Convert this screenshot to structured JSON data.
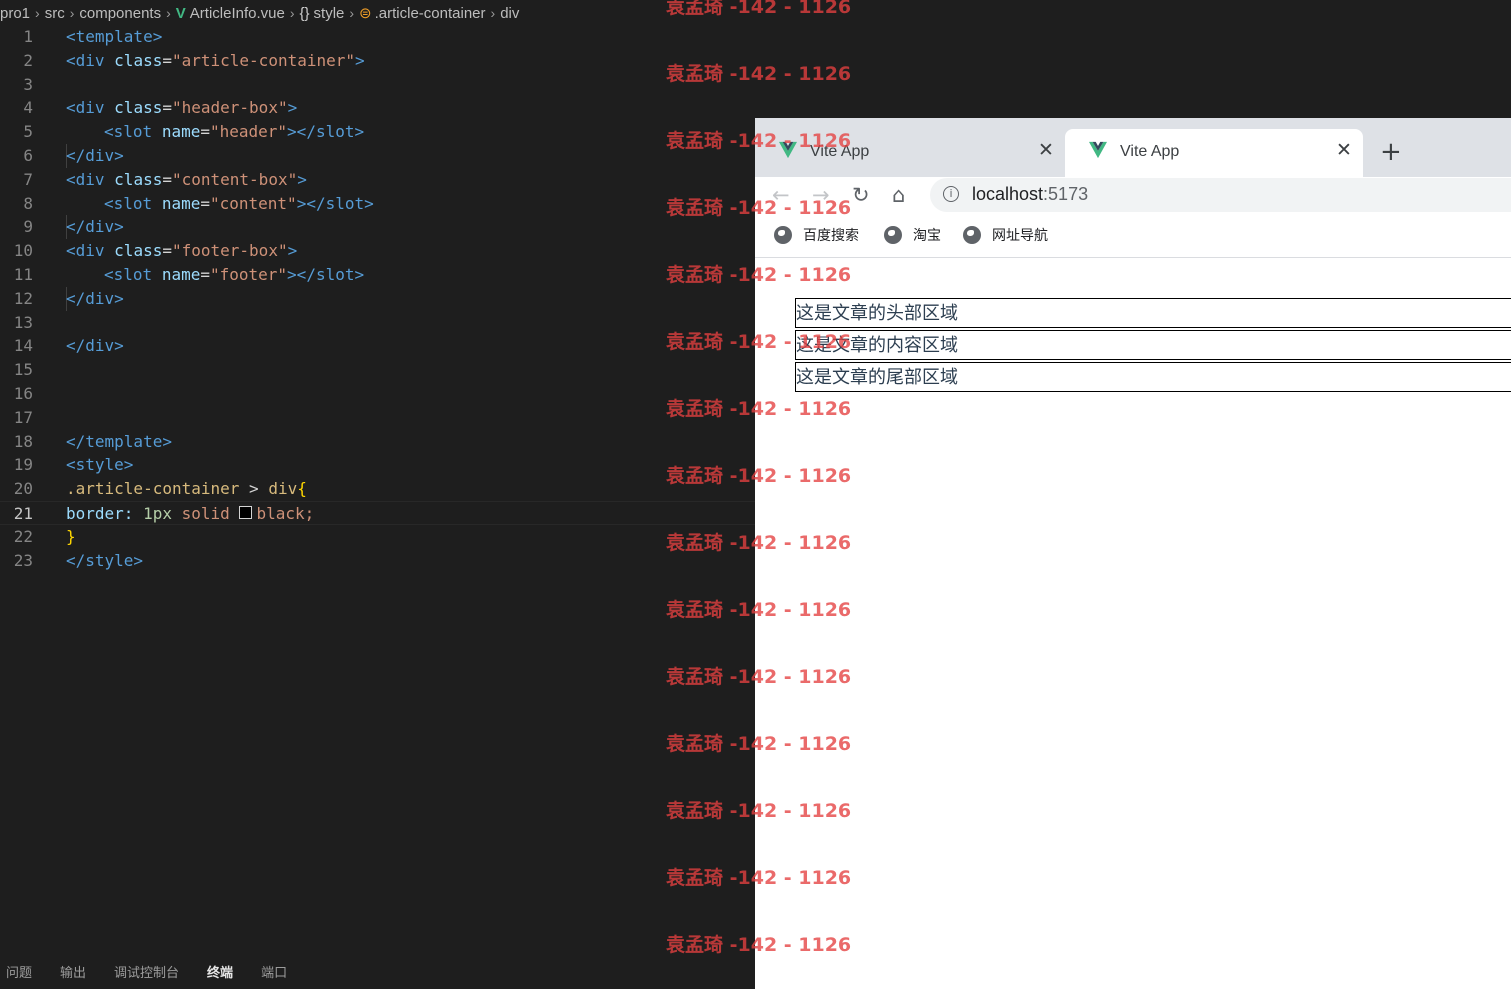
{
  "editor": {
    "breadcrumb": {
      "parts": [
        "pro1",
        "src",
        "components",
        "ArticleInfo.vue",
        "style",
        ".article-container",
        "div"
      ]
    },
    "current_line": 21,
    "lines": [
      {
        "n": "1"
      },
      {
        "n": "2"
      },
      {
        "n": "3"
      },
      {
        "n": "4"
      },
      {
        "n": "5"
      },
      {
        "n": "6"
      },
      {
        "n": "7"
      },
      {
        "n": "8"
      },
      {
        "n": "9"
      },
      {
        "n": "10"
      },
      {
        "n": "11"
      },
      {
        "n": "12"
      },
      {
        "n": "13"
      },
      {
        "n": "14"
      },
      {
        "n": "15"
      },
      {
        "n": "16"
      },
      {
        "n": "17"
      },
      {
        "n": "18"
      },
      {
        "n": "19"
      },
      {
        "n": "20"
      },
      {
        "n": "21"
      },
      {
        "n": "22"
      },
      {
        "n": "23"
      }
    ],
    "code": {
      "l1": "<template>",
      "l2_tag": "<div",
      "l2_attr": "class",
      "l2_val": "\"article-container\"",
      "l4_val": "\"header-box\"",
      "l5_attr": "name",
      "l5_val": "\"header\"",
      "slot_open": "<slot",
      "slot_close": "></slot>",
      "div_close": "</div>",
      "div_open": "<div",
      "class_attr": "class",
      "l7_val": "\"content-box\"",
      "l8_val": "\"content\"",
      "l10_val": "\"footer-box\"",
      "l11_val": "\"footer\"",
      "l18": "</template>",
      "l19": "<style>",
      "l20_sel": ".article-container",
      "l20_gt": ">",
      "l20_div": "div",
      "l20_brace": "{",
      "l21_prop": "border:",
      "l21_num": "1px",
      "l21_kw": "solid",
      "l21_color": "black;",
      "l22": "}",
      "l23": "</style>",
      "eq": "=",
      "gt": ">"
    },
    "panel_tabs": [
      "问题",
      "输出",
      "调试控制台",
      "终端",
      "端口"
    ],
    "panel_active": "终端"
  },
  "browser": {
    "tabs": [
      {
        "title": "Vite App"
      },
      {
        "title": "Vite App"
      }
    ],
    "close_glyph": "✕",
    "new_tab_glyph": "+",
    "url_host": "localhost",
    "url_port": ":5173",
    "bookmarks": [
      "百度搜索",
      "淘宝",
      "网址导航"
    ],
    "page": {
      "header": "这是文章的头部区域",
      "content": "这是文章的内容区域",
      "footer": "这是文章的尾部区域"
    },
    "accent_color": "#41b883"
  },
  "watermark": {
    "text": "袁孟琦 -142 - 1126",
    "color": "#e44040"
  }
}
